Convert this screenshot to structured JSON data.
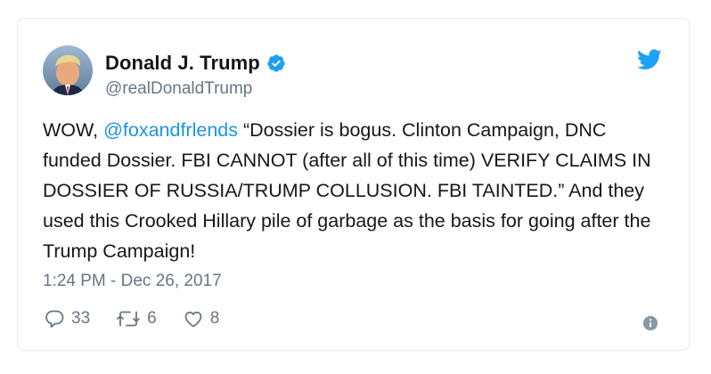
{
  "tweet": {
    "display_name": "Donald J. Trump",
    "handle": "@realDonaldTrump",
    "text_pre": "WOW, ",
    "mention": "@foxandfrlends",
    "text_post": " “Dossier is bogus. Clinton Campaign, DNC funded Dossier. FBI CANNOT (after all of this time) VERIFY CLAIMS IN DOSSIER OF RUSSIA/TRUMP COLLUSION. FBI TAINTED.” And they used this Crooked Hillary pile of garbage as the basis for going after the Trump Campaign!",
    "timestamp": "1:24 PM - Dec 26, 2017",
    "replies": "33",
    "retweets": "6",
    "likes": "8"
  },
  "colors": {
    "accent": "#1da1f2",
    "mention": "#1b95e0",
    "muted": "#657786",
    "text": "#14171a"
  },
  "icons": {
    "avatar": "profile-photo",
    "verified": "verified-badge-icon",
    "brand": "twitter-bird-icon",
    "reply": "reply-icon",
    "retweet": "retweet-icon",
    "like": "heart-icon",
    "info": "info-icon"
  }
}
